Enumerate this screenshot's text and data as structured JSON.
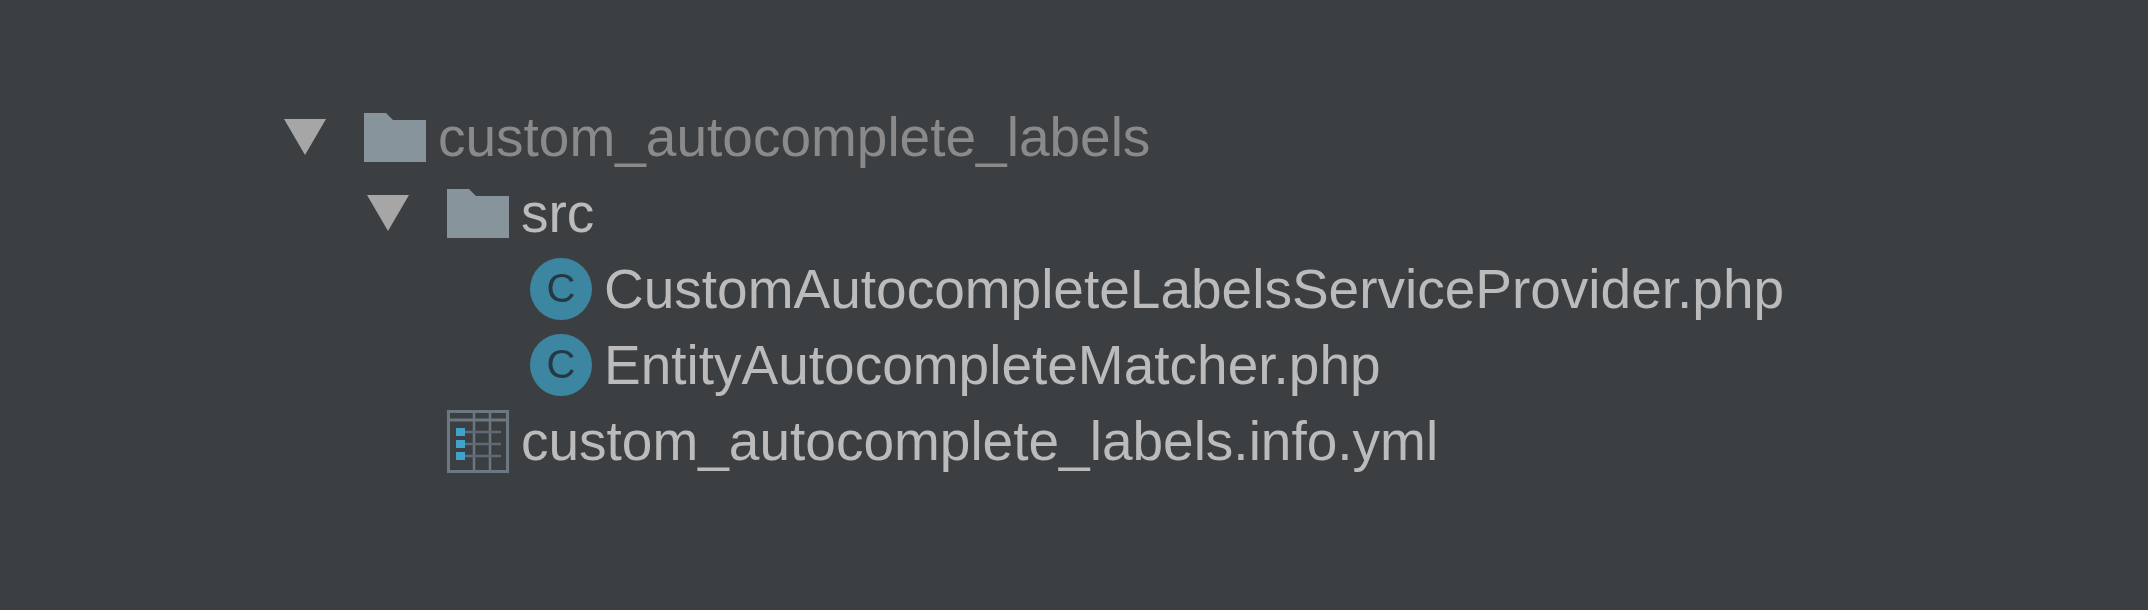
{
  "tree": [
    {
      "kind": "folder",
      "label": "custom_autocomplete_labels",
      "expanded": true,
      "dimmed": true,
      "children": [
        {
          "kind": "folder",
          "label": "src",
          "expanded": true,
          "dimmed": false,
          "children": [
            {
              "kind": "class",
              "badge": "C",
              "label": "CustomAutocompleteLabelsServiceProvider.php",
              "dimmed": false
            },
            {
              "kind": "class",
              "badge": "C",
              "label": "EntityAutocompleteMatcher.php",
              "dimmed": false
            }
          ]
        },
        {
          "kind": "config",
          "label": "custom_autocomplete_labels.info.yml",
          "dimmed": false
        }
      ]
    }
  ]
}
